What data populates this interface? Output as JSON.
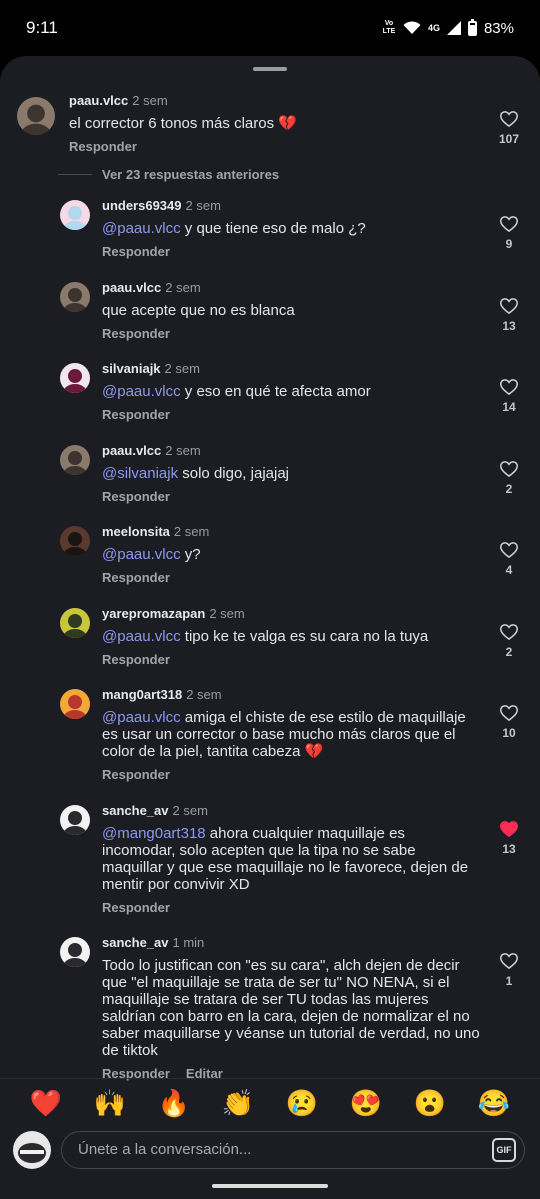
{
  "status_bar": {
    "time": "9:11",
    "network": "4G",
    "volte": "Vo LTE",
    "battery": "83%"
  },
  "comments": [
    {
      "user": "paau.vlcc",
      "age": "2 sem",
      "mention": "",
      "text": "el corrector 6 tonos más claros 💔",
      "reply": "Responder",
      "edit": "",
      "likes": "107",
      "liked": false,
      "avatar": [
        "#8a7a6c",
        "#3d3430"
      ]
    },
    {
      "user": "unders69349",
      "age": "2 sem",
      "mention": "@paau.vlcc",
      "text": " y que tiene eso de malo ¿?",
      "reply": "Responder",
      "edit": "",
      "likes": "9",
      "liked": false,
      "avatar": [
        "#f5d9e6",
        "#b0d8ef"
      ]
    },
    {
      "user": "paau.vlcc",
      "age": "2 sem",
      "mention": "",
      "text": "que acepte que no es blanca",
      "reply": "Responder",
      "edit": "",
      "likes": "13",
      "liked": false,
      "avatar": [
        "#8a7a6c",
        "#3d3430"
      ]
    },
    {
      "user": "silvaniajk",
      "age": "2 sem",
      "mention": "@paau.vlcc",
      "text": " y eso en qué te afecta amor",
      "reply": "Responder",
      "edit": "",
      "likes": "14",
      "liked": false,
      "avatar": [
        "#f0e6ef",
        "#6b1a3c"
      ]
    },
    {
      "user": "paau.vlcc",
      "age": "2 sem",
      "mention": "@silvaniajk",
      "text": " solo digo, jajajaj",
      "reply": "Responder",
      "edit": "",
      "likes": "2",
      "liked": false,
      "avatar": [
        "#8a7a6c",
        "#3d3430"
      ]
    },
    {
      "user": "meelonsita",
      "age": "2 sem",
      "mention": "@paau.vlcc",
      "text": " y?",
      "reply": "Responder",
      "edit": "",
      "likes": "4",
      "liked": false,
      "avatar": [
        "#5a3a2c",
        "#1c1414"
      ]
    },
    {
      "user": "yarepromazapan",
      "age": "2 sem",
      "mention": "@paau.vlcc",
      "text": " tipo ke te valga es su cara no la tuya",
      "reply": "Responder",
      "edit": "",
      "likes": "2",
      "liked": false,
      "avatar": [
        "#c8c73a",
        "#2f3a22"
      ]
    },
    {
      "user": "mang0art318",
      "age": "2 sem",
      "mention": "@paau.vlcc",
      "text": " amiga el chiste de ese estilo de maquillaje es usar un corrector o base mucho más claros que el color de la piel, tantita cabeza 💔",
      "reply": "Responder",
      "edit": "",
      "likes": "10",
      "liked": false,
      "avatar": [
        "#f3a93a",
        "#b8372c"
      ]
    },
    {
      "user": "sanche_av",
      "age": "2 sem",
      "mention": "@mang0art318",
      "text": " ahora cualquier maquillaje es incomodar, solo acepten que la tipa no se sabe maquillar y que ese maquillaje no le favorece, dejen de mentir por convivir XD",
      "reply": "Responder",
      "edit": "",
      "likes": "13",
      "liked": true,
      "avatar": [
        "#f2f2f2",
        "#2a2a2e"
      ]
    },
    {
      "user": "sanche_av",
      "age": "1 min",
      "mention": "",
      "text": "Todo lo justifican con \"es su cara\", alch dejen de decir que \"el maquillaje se trata de ser tu\" NO NENA, si el maquillaje se tratara de ser TU todas las mujeres saldrían con barro en la cara, dejen de normalizar el no saber maquillarse y véanse un tutorial de verdad, no uno de tiktok",
      "reply": "Responder",
      "edit": "Editar",
      "likes": "1",
      "liked": false,
      "avatar": [
        "#f2f2f2",
        "#2a2a2e"
      ]
    }
  ],
  "view_more": "Ver 23 respuestas anteriores",
  "emojis": [
    "❤️",
    "🙌",
    "🔥",
    "👏",
    "😢",
    "😍",
    "😮",
    "😂"
  ],
  "input": {
    "placeholder": "Únete a la conversación...",
    "gif": "GIF"
  },
  "colors": {
    "background": "#1b1d22",
    "mention": "#8f98ef",
    "liked": "#fe2c55"
  }
}
